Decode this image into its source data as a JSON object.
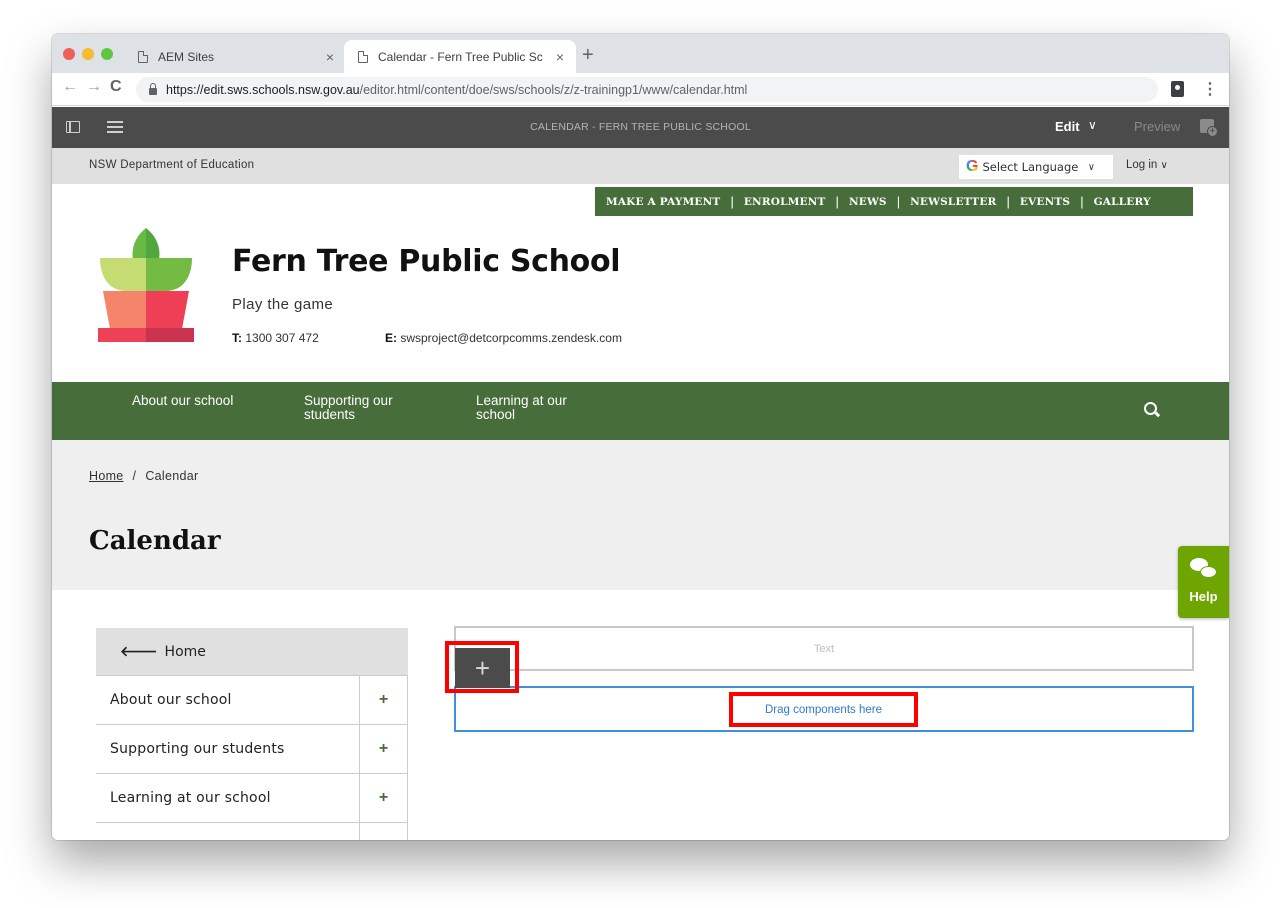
{
  "browser": {
    "tabs": [
      {
        "title": "AEM Sites",
        "active": false
      },
      {
        "title": "Calendar - Fern Tree Public Sc",
        "active": true
      }
    ],
    "new_tab": "+",
    "close": "×",
    "url_host": "https://edit.sws.schools.nsw.gov.au",
    "url_path": "/editor.html/content/doe/sws/schools/z/z-trainingp1/www/calendar.html",
    "nav": {
      "back": "←",
      "forward": "→",
      "reload": "C"
    },
    "menu": "⋮"
  },
  "editor": {
    "title": "CALENDAR - FERN TREE PUBLIC SCHOOL",
    "mode": "Edit",
    "mode_chevron": "∨",
    "preview": "Preview"
  },
  "site": {
    "department": "NSW Department of Education",
    "language_select": "Select Language",
    "language_logo": "G",
    "login": "Log in",
    "chevron": "∨",
    "top_nav": [
      "MAKE A PAYMENT",
      "ENROLMENT",
      "NEWS",
      "NEWSLETTER",
      "EVENTS",
      "GALLERY"
    ],
    "top_nav_separator": "|",
    "school_name": "Fern Tree Public School",
    "tagline": "Play the game",
    "phone_label": "T:",
    "phone": "1300 307 472",
    "email_label": "E:",
    "email": "swsproject@detcorpcomms.zendesk.com",
    "main_nav": [
      {
        "line1": "About our school",
        "line2": ""
      },
      {
        "line1": "Supporting our",
        "line2": "students"
      },
      {
        "line1": "Learning at our",
        "line2": "school"
      }
    ],
    "breadcrumb": {
      "home": "Home",
      "separator": "/",
      "current": "Calendar"
    },
    "page_title": "Calendar",
    "help_label": "Help",
    "side_menu": {
      "home_arrow": "🡐",
      "home_label": "Home",
      "items": [
        {
          "label": "About our school",
          "expand": "+"
        },
        {
          "label": "Supporting our students",
          "expand": "+"
        },
        {
          "label": "Learning at our school",
          "expand": "+"
        },
        {
          "label": "",
          "expand": ""
        }
      ]
    }
  },
  "components": {
    "text_placeholder": "Text",
    "insert_button": "+",
    "drop_zone": "Drag components here"
  },
  "colors": {
    "brand_green": "#466d3a",
    "help_green": "#6fa500",
    "editor_bar": "#4b4b4b",
    "highlight_red": "#ff0000",
    "dropzone_blue": "#3f8fe0"
  }
}
